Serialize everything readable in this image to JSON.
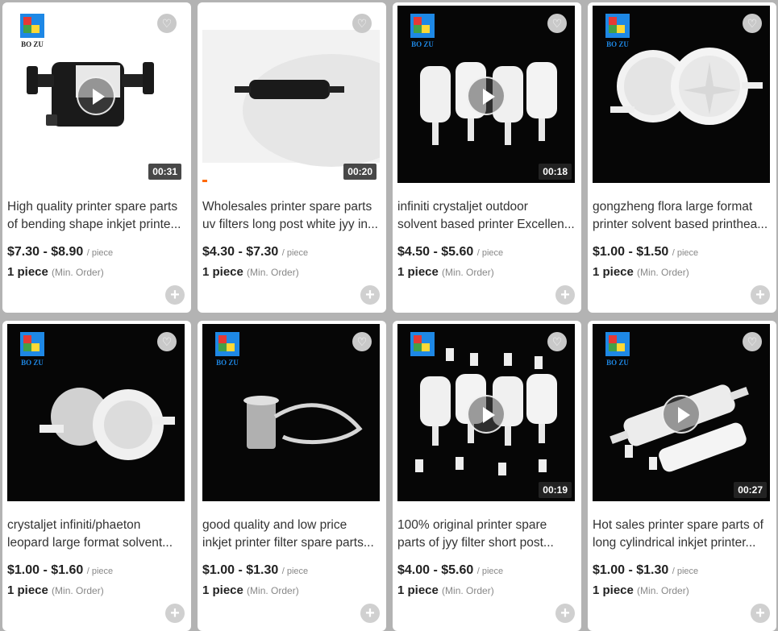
{
  "products": [
    {
      "title_line1": "High quality printer spare parts",
      "title_line2": "of bending shape inkjet printe...",
      "price": "$7.30 - $8.90",
      "price_unit": "/ piece",
      "moq": "1 piece",
      "moq_note": "(Min. Order)",
      "duration": "00:31",
      "has_video": true,
      "logo_text": "BO ZU",
      "image_theme": "light"
    },
    {
      "title_line1": "Wholesales printer spare parts",
      "title_line2": "uv filters long post white jyy in...",
      "price": "$4.30 - $7.30",
      "price_unit": "/ piece",
      "moq": "1 piece",
      "moq_note": "(Min. Order)",
      "duration": "00:20",
      "has_video": true,
      "image_theme": "light"
    },
    {
      "title_line1": "infiniti crystaljet outdoor",
      "title_line2": "solvent based printer Excellen...",
      "price": "$4.50 - $5.60",
      "price_unit": "/ piece",
      "moq": "1 piece",
      "moq_note": "(Min. Order)",
      "duration": "00:18",
      "has_video": true,
      "logo_text": "BO ZU",
      "image_theme": "dark"
    },
    {
      "title_line1": "gongzheng flora large format",
      "title_line2": "printer solvent based printhea...",
      "price": "$1.00 - $1.50",
      "price_unit": "/ piece",
      "moq": "1 piece",
      "moq_note": "(Min. Order)",
      "has_video": false,
      "logo_text": "BO ZU",
      "image_theme": "dark"
    },
    {
      "title_line1": "crystaljet infiniti/phaeton",
      "title_line2": "leopard large format solvent...",
      "price": "$1.00 - $1.60",
      "price_unit": "/ piece",
      "moq": "1 piece",
      "moq_note": "(Min. Order)",
      "has_video": false,
      "logo_text": "BO ZU",
      "image_theme": "dark"
    },
    {
      "title_line1": "good quality and low price",
      "title_line2": "inkjet printer filter spare parts...",
      "price": "$1.00 - $1.30",
      "price_unit": "/ piece",
      "moq": "1 piece",
      "moq_note": "(Min. Order)",
      "has_video": false,
      "logo_text": "BO ZU",
      "image_theme": "dark"
    },
    {
      "title_line1": "100% original printer spare",
      "title_line2": "parts of jyy filter short post...",
      "price": "$4.00 - $5.60",
      "price_unit": "/ piece",
      "moq": "1 piece",
      "moq_note": "(Min. Order)",
      "duration": "00:19",
      "has_video": true,
      "image_theme": "dark"
    },
    {
      "title_line1": "Hot sales printer spare parts of",
      "title_line2": "long cylindrical inkjet printer...",
      "price": "$1.00 - $1.30",
      "price_unit": "/ piece",
      "moq": "1 piece",
      "moq_note": "(Min. Order)",
      "duration": "00:27",
      "has_video": true,
      "logo_text": "BO ZU",
      "image_theme": "dark"
    }
  ],
  "icons": {
    "favorite": "heart-icon",
    "add": "plus-icon",
    "play": "play-icon"
  },
  "colors": {
    "page_bg": "#b3b3b3",
    "card_bg": "#ffffff",
    "price_text": "#222222",
    "muted_text": "#888888",
    "accent_orange": "#ff6a00"
  }
}
